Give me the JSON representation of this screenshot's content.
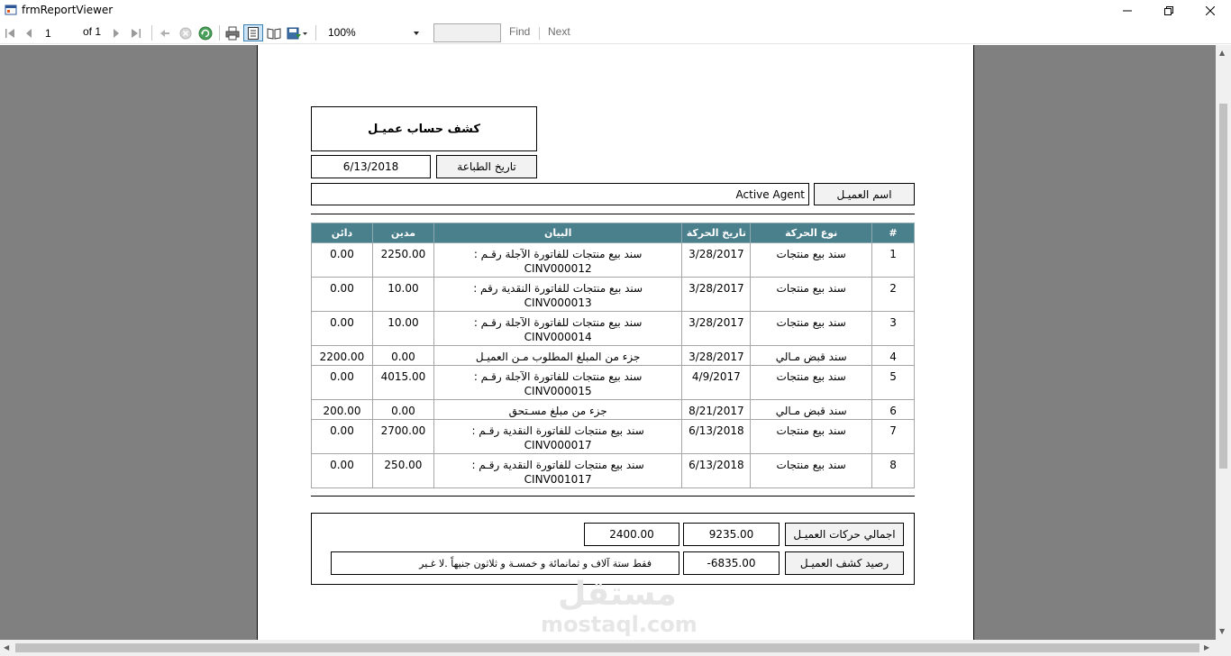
{
  "window": {
    "title": "frmReportViewer"
  },
  "toolbar": {
    "page_current": "1",
    "page_of_label": "of",
    "page_total": "1",
    "zoom": "100%",
    "find_label": "Find",
    "next_label": "Next"
  },
  "report": {
    "title": "كشف حساب عميـل",
    "print_date_label": "تاريخ الطباعة",
    "print_date": "6/13/2018",
    "customer_label": "اسم العميـل",
    "customer_name": "Active Agent",
    "columns": [
      "#",
      "نوع الحركة",
      "تاريخ الحركة",
      "البيان",
      "مدين",
      "دائن"
    ],
    "rows": [
      {
        "num": "1",
        "type": "سند بيع منتجات",
        "date": "3/28/2017",
        "desc1": "سند بيع منتجات للفاتورة الآجلة رقـم :",
        "desc2": "CINV000012",
        "debit": "2250.00",
        "credit": "0.00"
      },
      {
        "num": "2",
        "type": "سند بيع منتجات",
        "date": "3/28/2017",
        "desc1": "سند بيع منتجات للفاتورة النقدية رقم :",
        "desc2": "CINV000013",
        "debit": "10.00",
        "credit": "0.00"
      },
      {
        "num": "3",
        "type": "سند بيع منتجات",
        "date": "3/28/2017",
        "desc1": "سند بيع منتجات للفاتورة الآجلة رقـم :",
        "desc2": "CINV000014",
        "debit": "10.00",
        "credit": "0.00"
      },
      {
        "num": "4",
        "type": "سند قبض مـالي",
        "date": "3/28/2017",
        "desc1": "جزء من المبلغ المطلوب مـن العميـل",
        "desc2": "",
        "debit": "0.00",
        "credit": "2200.00"
      },
      {
        "num": "5",
        "type": "سند بيع منتجات",
        "date": "4/9/2017",
        "desc1": "سند بيع منتجات للفاتورة الآجلة رقـم :",
        "desc2": "CINV000015",
        "debit": "4015.00",
        "credit": "0.00"
      },
      {
        "num": "6",
        "type": "سند قبض مـالي",
        "date": "8/21/2017",
        "desc1": "جزء من مبلغ مسـتحق",
        "desc2": "",
        "debit": "0.00",
        "credit": "200.00"
      },
      {
        "num": "7",
        "type": "سند بيع منتجات",
        "date": "6/13/2018",
        "desc1": "سند بيع منتجات للفاتورة النقدية رقـم :",
        "desc2": "CINV000017",
        "debit": "2700.00",
        "credit": "0.00"
      },
      {
        "num": "8",
        "type": "سند بيع منتجات",
        "date": "6/13/2018",
        "desc1": "سند بيع منتجات للفاتورة النقدية رقـم :",
        "desc2": "CINV001017",
        "debit": "250.00",
        "credit": "0.00"
      }
    ],
    "totals_label": "اجمالي حركات العميـل",
    "total_debit": "9235.00",
    "total_credit": "2400.00",
    "balance_label": "رصيد كشف العميـل",
    "balance": "-6835.00",
    "balance_words": "فقط ستة آلاف و ثمانمائة و خمسـة و ثلاثون جنيهاً .لا غـير"
  },
  "watermark": {
    "arabic": "مستقل",
    "latin": "mostaql.com"
  }
}
